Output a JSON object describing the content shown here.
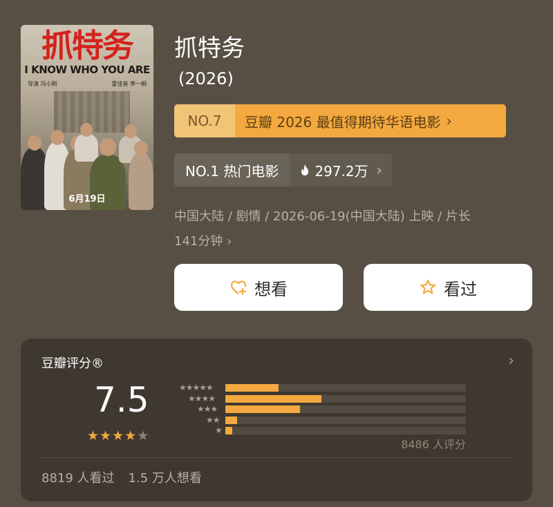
{
  "poster": {
    "title": "抓特务",
    "subtitle": "I KNOW WHO YOU ARE",
    "credits_left": "导演 冯小刚",
    "credits_right": "雷佳音 李一桐",
    "date": "6月19日"
  },
  "movie": {
    "title": "抓特务",
    "year": "(2026)"
  },
  "ranking": {
    "no": "NO.7",
    "text": "豆瓣 2026 最值得期待华语电影"
  },
  "hot": {
    "label": "NO.1 热门电影",
    "count": "297.2万"
  },
  "meta": {
    "line1": "中国大陆 / 剧情 / 2026-06-19(中国大陆) 上映 / 片长",
    "line2": "141分钟"
  },
  "buttons": {
    "want_label": "想看",
    "seen_label": "看过"
  },
  "rating": {
    "label": "豆瓣评分®",
    "score": "7.5",
    "stars_filled": 4,
    "stars_total": 5,
    "distribution": [
      {
        "stars": 5,
        "fraction": 0.22
      },
      {
        "stars": 4,
        "fraction": 0.4
      },
      {
        "stars": 3,
        "fraction": 0.31
      },
      {
        "stars": 2,
        "fraction": 0.05
      },
      {
        "stars": 1,
        "fraction": 0.03
      }
    ],
    "count_text": "8486 人评分",
    "seen_text": "8819 人看过",
    "want_text": "1.5 万人想看"
  },
  "colors": {
    "background": "#574f43",
    "accent": "#f3a93f",
    "card": "#3e3830"
  }
}
